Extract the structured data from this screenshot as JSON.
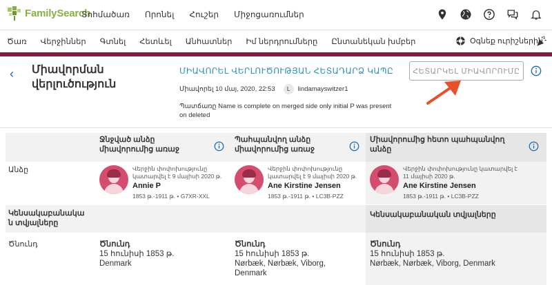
{
  "header": {
    "logo_text": "FamilySearch",
    "nav": [
      "Տոհմածառ",
      "Որոնել",
      "Հուշեր",
      "Միջոցառումներ"
    ],
    "icons": [
      "location-icon",
      "globe-icon",
      "help-icon",
      "messages-icon",
      "bell-icon"
    ]
  },
  "subnav": {
    "items": [
      "Ծառ",
      "Վերջիններ",
      "Գտնել",
      "Հետևել",
      "Անհատներ",
      "Իմ ներդրումները",
      "Ընտանեկան խմբեր"
    ],
    "help_label": "Օգնեք ուրիշներին"
  },
  "page": {
    "back_symbol": "‹",
    "title": "Միավորման վերլուծություն",
    "link_title": "ՄԻԱՎՈՐԵԼ ՎԵՐԼՈՒԾՈՒԹՅԱՆ ՀԵՏԱԴԱՐՁ ԿԱՊԸ",
    "meta_date": "Միավորել 10 մայ, 2020, 22:53",
    "meta_avatar_letter": "L",
    "meta_user": "lindamayswitzer1",
    "reason": "Պատճառը Name is complete on merged side only initial P was present on deleted",
    "revert_button": "ՀԵՏԱՐԿԵԼ ՄԻԱՎՈՐՈՒՄԸ"
  },
  "table": {
    "columns": [
      "Ջնջված անձը միավորումից առաջ",
      "Պահպանվող անձը միավորումից առաջ",
      "Միավորումից հետո պահպանվող անձը"
    ],
    "row_person_label": "Անձը",
    "persons": [
      {
        "changed": "Վերջին փոփոխությունը կատարվել է 9 մայիսի 2020 թ.",
        "name": "Annie P",
        "dates": "1853 թ.-1911 թ. • G7XR-XXL"
      },
      {
        "changed": "Վերջին փոփոխությունը կատարվել է 9 մայիսի 2020 թ.",
        "name": "Ane Kirstine Jensen",
        "dates": "1853 թ.-1911 թ. • LC3B-PZZ"
      },
      {
        "changed": "Վերջին փոփոխությունը կատարվել է 11 մայիսի 2020 թ.",
        "name": "Ane Kirstine Jensen",
        "dates": "1853 թ.-1911 թ. • LC3B-PZZ"
      }
    ],
    "vitals_label_left": "Կենսակաբանակա ն տվյալները",
    "vitals_label_right": "Կենսակաբանական տվյալները",
    "row_birth_label": "Ծնունդ",
    "births": [
      {
        "title": "Ծնունդ",
        "date": "15 հունիսի 1853 թ.",
        "place": "Denmark"
      },
      {
        "title": "Ծնունդ",
        "date": "15 հունիսի 1853 թ.",
        "place": "Nørbæk, Nørbæk, Viborg, Denmark"
      },
      {
        "title": "Ծնունդ",
        "date": "15 հունիսի 1853 թ.",
        "place": "Nørbæk, Nørbæk, Viborg, Denmark"
      }
    ]
  },
  "colors": {
    "brand_green": "#87b144",
    "maroon_bar": "#7e1f3c",
    "link_blue": "#2c8fbe",
    "arrow_red": "#e8502a",
    "avatar_pink": "#d44d6e"
  }
}
